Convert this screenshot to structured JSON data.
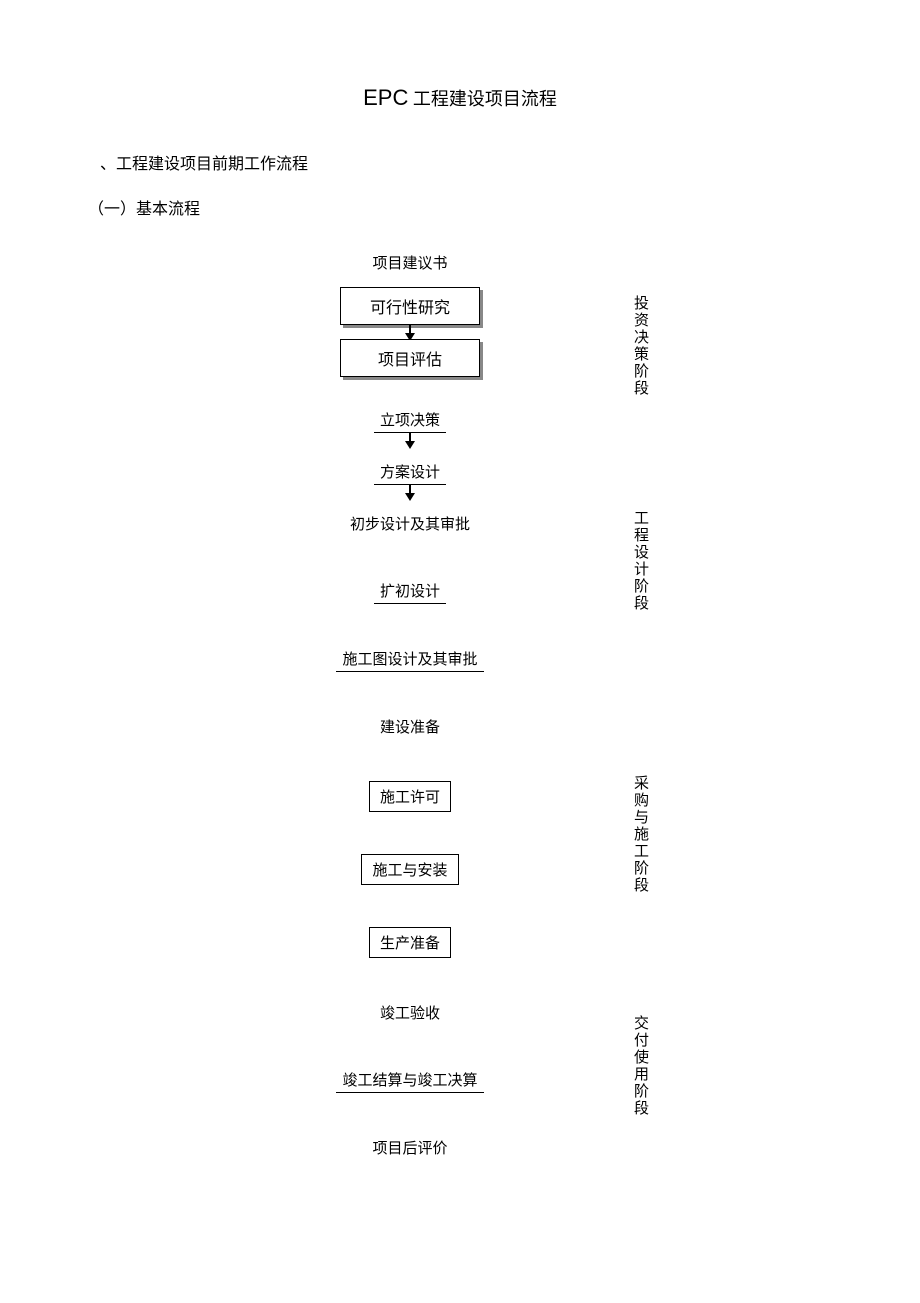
{
  "title_prefix": "EPC",
  "title_rest": " 工程建设项目流程",
  "section1": "、工程建设项目前期工作流程",
  "section2": "（一）基本流程",
  "steps": {
    "s1": "项目建议书",
    "s2": "可行性研究",
    "s3": "项目评估",
    "s4": "立项决策",
    "s5": "方案设计",
    "s6": "初步设计及其审批",
    "s7": "扩初设计",
    "s8": "施工图设计及其审批",
    "s9": "建设准备",
    "s10": "施工许可",
    "s11": "施工与安装",
    "s12": "生产准备",
    "s13": "竣工验收",
    "s14": "竣工结算与竣工决算",
    "s15": "项目后评价"
  },
  "phases": {
    "p1": "投资决策阶段",
    "p2": "工程设计阶段",
    "p3": "采购与施工阶段",
    "p4": "交付使用阶段"
  }
}
